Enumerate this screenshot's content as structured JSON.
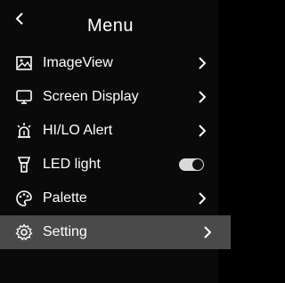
{
  "header": {
    "title": "Menu",
    "back_icon": "chevron-left-icon"
  },
  "menu": {
    "items": [
      {
        "label": "ImageView",
        "icon": "image-icon",
        "control": "chevron"
      },
      {
        "label": "Screen Display",
        "icon": "monitor-icon",
        "control": "chevron"
      },
      {
        "label": "HI/LO Alert",
        "icon": "alert-beacon-icon",
        "control": "chevron"
      },
      {
        "label": "LED light",
        "icon": "flashlight-icon",
        "control": "toggle",
        "toggle_on": false
      },
      {
        "label": "Palette",
        "icon": "palette-icon",
        "control": "chevron"
      },
      {
        "label": "Setting",
        "icon": "gear-icon",
        "control": "chevron",
        "selected": true
      }
    ]
  },
  "colors": {
    "background": "#0a0a0a",
    "selected_row": "#4a4a4a",
    "text": "#ffffff",
    "toggle_track": "#d9d9d9"
  }
}
